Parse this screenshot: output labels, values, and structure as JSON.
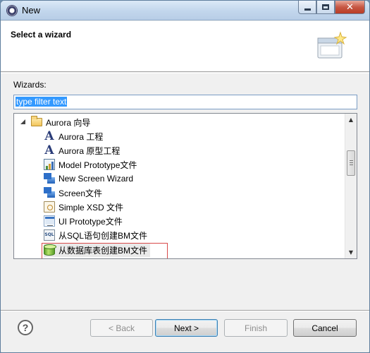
{
  "window": {
    "title": "New"
  },
  "header": {
    "title": "Select a wizard"
  },
  "wizards_label": "Wizards:",
  "filter": {
    "value": "type filter text"
  },
  "tree": {
    "root": "Aurora 向导",
    "items": [
      {
        "label": "Aurora 工程",
        "icon": "aurora-a-icon"
      },
      {
        "label": "Aurora 原型工程",
        "icon": "aurora-a-icon"
      },
      {
        "label": "Model Prototype文件",
        "icon": "model-prototype-icon"
      },
      {
        "label": "New Screen Wizard",
        "icon": "screen-icon"
      },
      {
        "label": "Screen文件",
        "icon": "screen-icon"
      },
      {
        "label": "Simple XSD 文件",
        "icon": "xsd-icon"
      },
      {
        "label": "UI Prototype文件",
        "icon": "ui-prototype-icon"
      },
      {
        "label": "从SQL语句创建BM文件",
        "icon": "sql-icon"
      },
      {
        "label": "从数据库表创建BM文件",
        "icon": "database-icon"
      }
    ]
  },
  "buttons": {
    "help": "?",
    "back": "< Back",
    "next": "Next >",
    "finish": "Finish",
    "cancel": "Cancel"
  },
  "colors": {
    "highlight": "#d84a4a",
    "accent": "#3399ff"
  }
}
